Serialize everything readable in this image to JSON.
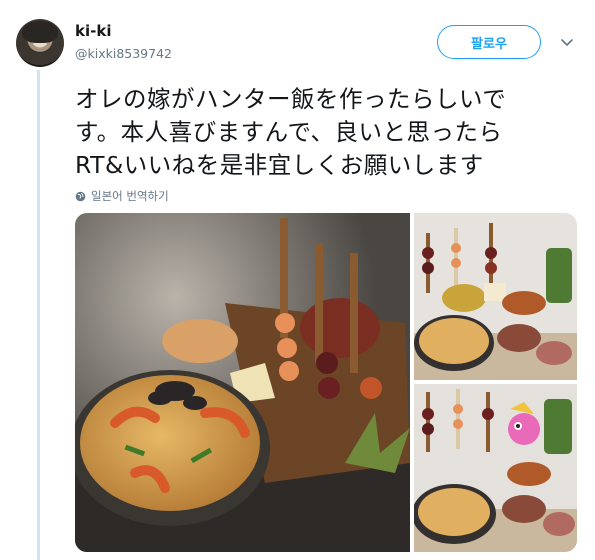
{
  "user": {
    "name": "ki-ki",
    "handle": "@kixki8539742"
  },
  "actions": {
    "follow_label": "팔로우"
  },
  "tweet": {
    "lines": [
      "オレの嫁がハンター飯を作ったらしいで",
      "す。本人喜びますんで、良いと思ったら",
      "RT&いいねを是非宜しくお願いします"
    ],
    "translate_label": "일본어 번역하기"
  },
  "colors": {
    "accent": "#1da1f2",
    "secondary_text": "#657786",
    "thread_line": "#cfe3f3"
  },
  "icons": {
    "menu": "chevron-down-icon",
    "translate": "globe-icon"
  }
}
